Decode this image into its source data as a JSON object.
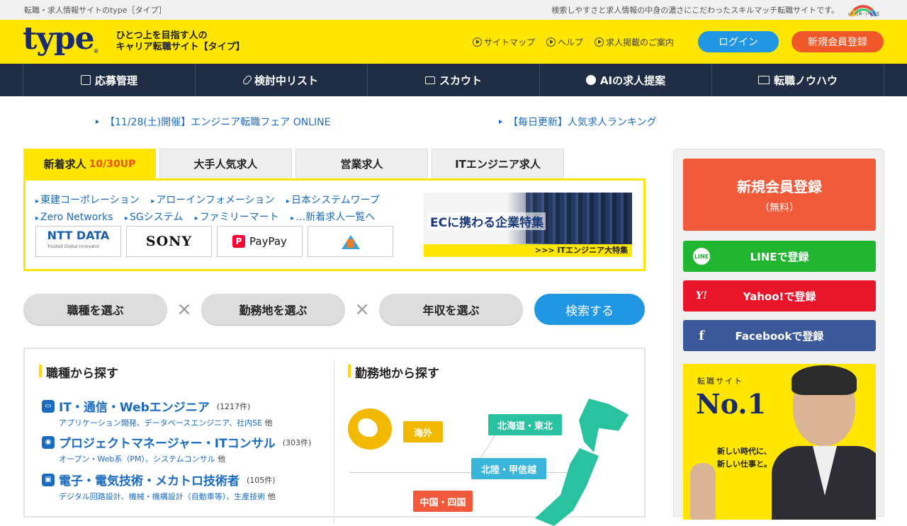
{
  "topstrip": {
    "left_text": "転職・求人情報サイトのtype［タイプ］",
    "right_text": "検索しやすさと求人情報の中身の濃さにこだわったスキルマッチ転職サイトです。",
    "badge_caption": "いい仕事・いい人生"
  },
  "header": {
    "logo": "type",
    "logo_mark": "®",
    "tagline_line1": "ひとつ上を目指す人の",
    "tagline_line2": "キャリア転職サイト【タイプ】",
    "links": [
      "サイトマップ",
      "ヘルプ",
      "求人掲載のご案内"
    ],
    "login_label": "ログイン",
    "register_label": "新規会員登録"
  },
  "nav": [
    {
      "label": "応募管理",
      "icon": "clipboard-icon"
    },
    {
      "label": "検討中リスト",
      "icon": "paperclip-icon"
    },
    {
      "label": "スカウト",
      "icon": "mail-icon"
    },
    {
      "label": "AIの求人提案",
      "icon": "ai-icon"
    },
    {
      "label": "転職ノウハウ",
      "icon": "book-icon"
    }
  ],
  "news": [
    "【11/28(土)開催】エンジニア転職フェア ONLINE",
    "【毎日更新】人気求人ランキング"
  ],
  "tabs": {
    "items": [
      "新着求人",
      "大手人気求人",
      "営業求人",
      "ITエンジニア求人"
    ],
    "active_badge": "10/30UP"
  },
  "companies": [
    "東建コーポレーション",
    "アローインフォメーション",
    "日本システムワープ",
    "Zero Networks",
    "SGシステム",
    "ファミリーマート",
    "…新着求人一覧へ"
  ],
  "logos": {
    "ntt": "NTT DATA",
    "ntt_sub": "Trusted Global Innovator",
    "sony": "SONY",
    "paypay": "PayPay",
    "paypay_mark": "P"
  },
  "banner": {
    "title": "ECに携わる企業特集",
    "footer": ">>> ITエンジニア大特集"
  },
  "search": {
    "job_type": "職種を選ぶ",
    "location": "勤務地を選ぶ",
    "salary": "年収を選ぶ",
    "submit": "検索する",
    "separator": "×"
  },
  "by_job": {
    "title": "職種から探す",
    "items": [
      {
        "title": "IT・通信・Webエンジニア",
        "count": "(1217件)",
        "desc": "アプリケーション開発、データベースエンジニア、社内SE",
        "more": "他"
      },
      {
        "title": "プロジェクトマネージャー・ITコンサル",
        "count": "(303件)",
        "desc": "オープン・Web系（PM）、システムコンサル",
        "more": "他"
      },
      {
        "title": "電子・電気技術・メカトロ技術者",
        "count": "(105件)",
        "desc": "デジタル回路設計、機械・機構設計（自動車等）、生産技術",
        "more": "他"
      }
    ]
  },
  "by_location": {
    "title": "勤務地から探す",
    "regions": [
      "海外",
      "北海道・東北",
      "北陸・甲信越",
      "中国・四国"
    ]
  },
  "sidebar": {
    "register_title": "新規会員登録",
    "register_sub": "（無料）",
    "line_label": "LINEで登録",
    "line_icon": "LINE",
    "yahoo_label": "Yahoo!で登録",
    "yahoo_icon": "Y!",
    "facebook_label": "Facebookで登録",
    "facebook_icon": "f",
    "ad_small": "転職サイト",
    "ad_no1": "No.1",
    "ad_msg1": "新しい時代に、",
    "ad_msg2": "新しい仕事と。"
  },
  "colors": {
    "brand_yellow": "#ffe600",
    "nav_dark": "#1f2e45",
    "link_blue": "#1a6bbf",
    "login_blue": "#2196e3",
    "register_orange": "#f0582a"
  }
}
